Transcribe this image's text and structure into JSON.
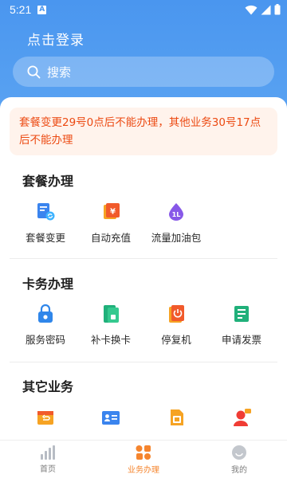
{
  "status_bar": {
    "time": "5:21",
    "notif_letter": "A"
  },
  "header": {
    "login_title": "点击登录",
    "search_placeholder": "搜索"
  },
  "notice": {
    "text": "套餐变更29号0点后不能办理，其他业务30号17点后不能办理"
  },
  "sections": [
    {
      "title": "套餐办理",
      "items": [
        {
          "label": "套餐变更",
          "icon": "plan-change-icon"
        },
        {
          "label": "自动充值",
          "icon": "auto-recharge-icon"
        },
        {
          "label": "流量加油包",
          "icon": "data-boost-icon"
        }
      ]
    },
    {
      "title": "卡务办理",
      "items": [
        {
          "label": "服务密码",
          "icon": "service-password-icon"
        },
        {
          "label": "补卡换卡",
          "icon": "sim-replace-icon"
        },
        {
          "label": "停复机",
          "icon": "suspend-resume-icon"
        },
        {
          "label": "申请发票",
          "icon": "invoice-icon"
        }
      ]
    },
    {
      "title": "其它业务",
      "items": [
        {
          "label": "",
          "icon": "return-icon"
        },
        {
          "label": "",
          "icon": "id-card-icon"
        },
        {
          "label": "",
          "icon": "sim-card-icon"
        },
        {
          "label": "",
          "icon": "customer-service-icon"
        }
      ]
    }
  ],
  "tabbar": [
    {
      "label": "首页",
      "icon": "home-bars-icon",
      "active": false
    },
    {
      "label": "业务办理",
      "icon": "business-grid-icon",
      "active": true
    },
    {
      "label": "我的",
      "icon": "profile-icon",
      "active": false
    }
  ],
  "colors": {
    "primary": "#4a96ef",
    "accent": "#f5852e",
    "notice_text": "#ec4a12",
    "notice_bg": "#fff3ec"
  }
}
